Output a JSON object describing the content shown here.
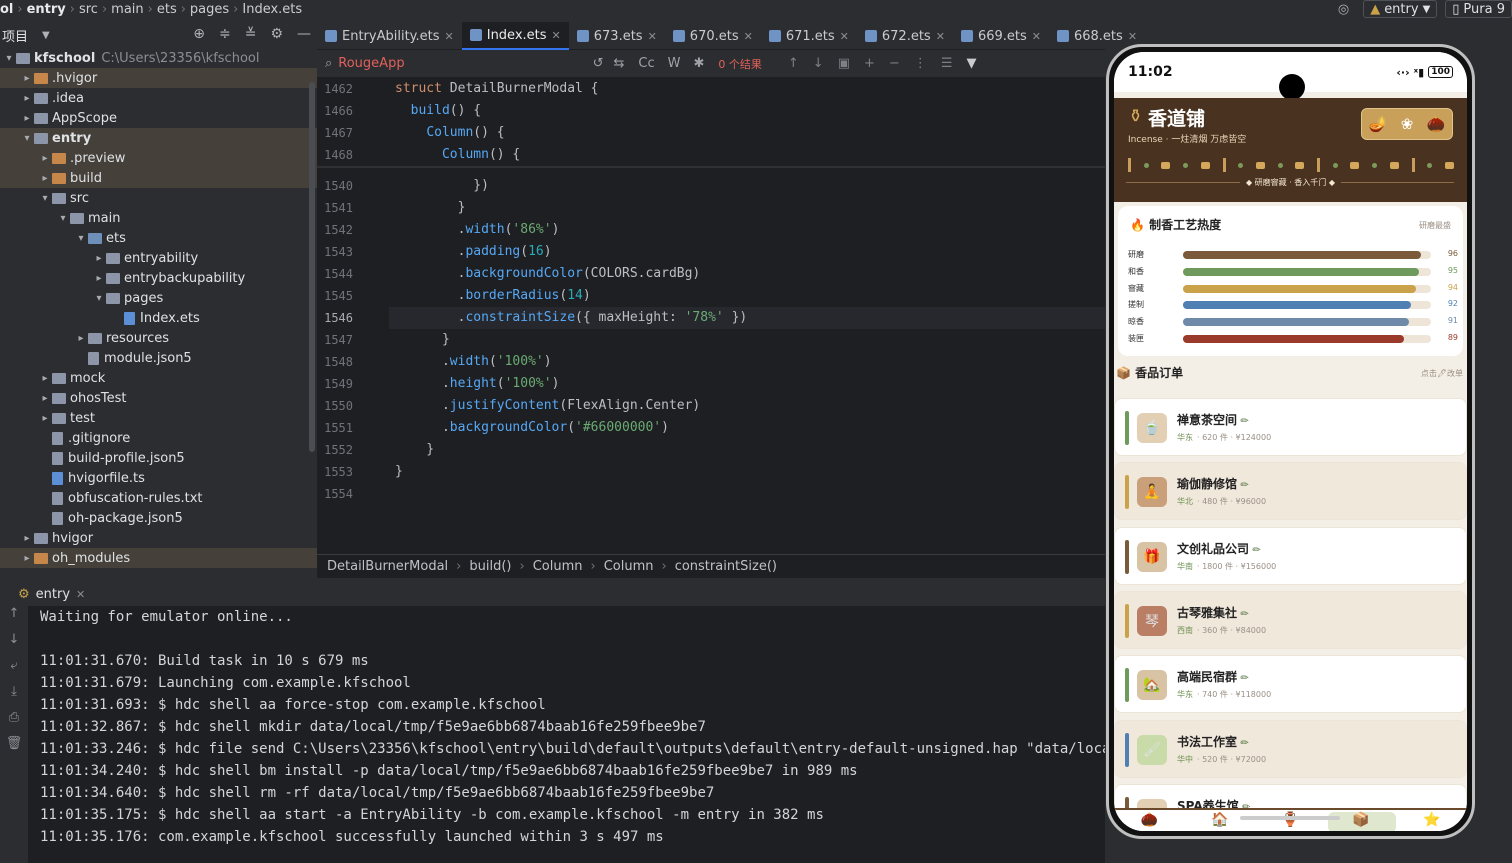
{
  "top_breadcrumb": {
    "items": [
      "ol",
      "entry",
      "src",
      "main",
      "ets",
      "pages",
      "Index.ets"
    ]
  },
  "run_config": {
    "label": "entry",
    "device": "Pura 9"
  },
  "project": {
    "title": "项目",
    "tree": [
      {
        "label": "kfschool",
        "path": "C:\\Users\\23356\\kfschool",
        "indent": 0,
        "bold": true,
        "arrow": "▾",
        "kind": "folder"
      },
      {
        "label": ".hvigor",
        "indent": 1,
        "arrow": "▸",
        "kind": "folder-orange",
        "hl": true
      },
      {
        "label": ".idea",
        "indent": 1,
        "arrow": "▸",
        "kind": "folder"
      },
      {
        "label": "AppScope",
        "indent": 1,
        "arrow": "▸",
        "kind": "folder"
      },
      {
        "label": "entry",
        "indent": 1,
        "arrow": "▾",
        "kind": "folder",
        "bold": true,
        "hl": true
      },
      {
        "label": ".preview",
        "indent": 2,
        "arrow": "▸",
        "kind": "folder-orange",
        "hl": true
      },
      {
        "label": "build",
        "indent": 2,
        "arrow": "▸",
        "kind": "folder-orange",
        "hl": true
      },
      {
        "label": "src",
        "indent": 2,
        "arrow": "▾",
        "kind": "folder"
      },
      {
        "label": "main",
        "indent": 3,
        "arrow": "▾",
        "kind": "folder"
      },
      {
        "label": "ets",
        "indent": 4,
        "arrow": "▾",
        "kind": "folder-blue"
      },
      {
        "label": "entryability",
        "indent": 5,
        "arrow": "▸",
        "kind": "folder"
      },
      {
        "label": "entrybackupability",
        "indent": 5,
        "arrow": "▸",
        "kind": "folder"
      },
      {
        "label": "pages",
        "indent": 5,
        "arrow": "▾",
        "kind": "folder"
      },
      {
        "label": "Index.ets",
        "indent": 6,
        "arrow": "",
        "kind": "file-ts"
      },
      {
        "label": "resources",
        "indent": 4,
        "arrow": "▸",
        "kind": "folder"
      },
      {
        "label": "module.json5",
        "indent": 4,
        "arrow": "",
        "kind": "file"
      },
      {
        "label": "mock",
        "indent": 2,
        "arrow": "▸",
        "kind": "folder"
      },
      {
        "label": "ohosTest",
        "indent": 2,
        "arrow": "▸",
        "kind": "folder"
      },
      {
        "label": "test",
        "indent": 2,
        "arrow": "▸",
        "kind": "folder"
      },
      {
        "label": ".gitignore",
        "indent": 2,
        "arrow": "",
        "kind": "file"
      },
      {
        "label": "build-profile.json5",
        "indent": 2,
        "arrow": "",
        "kind": "file"
      },
      {
        "label": "hvigorfile.ts",
        "indent": 2,
        "arrow": "",
        "kind": "file-ts"
      },
      {
        "label": "obfuscation-rules.txt",
        "indent": 2,
        "arrow": "",
        "kind": "file"
      },
      {
        "label": "oh-package.json5",
        "indent": 2,
        "arrow": "",
        "kind": "file"
      },
      {
        "label": "hvigor",
        "indent": 1,
        "arrow": "▸",
        "kind": "folder"
      },
      {
        "label": "oh_modules",
        "indent": 1,
        "arrow": "▸",
        "kind": "folder-orange",
        "hl": true
      }
    ]
  },
  "tabs": [
    "EntryAbility.ets",
    "Index.ets",
    "673.ets",
    "670.ets",
    "671.ets",
    "672.ets",
    "669.ets",
    "668.ets"
  ],
  "active_tab": "Index.ets",
  "find": {
    "query": "RougeApp",
    "result": "0 个结果",
    "case_label": "Cc",
    "word_label": "W"
  },
  "editor": {
    "sticky": [
      {
        "n": "1462",
        "html": "<span class=\"kw\">struct</span> <span class=\"ty\">DetailBurnerModal</span> {"
      },
      {
        "n": "1466",
        "html": "  <span class=\"fn\">build</span>() {"
      },
      {
        "n": "1467",
        "html": "    <span class=\"fn\">Column</span>() {"
      },
      {
        "n": "1468",
        "html": "      <span class=\"fn\">Column</span>() {"
      }
    ],
    "lines": [
      {
        "n": "1540",
        "html": "          })"
      },
      {
        "n": "1541",
        "html": "        }"
      },
      {
        "n": "1542",
        "html": "        .<span class=\"fn\">width</span>(<span class=\"st\">'86%'</span>)"
      },
      {
        "n": "1543",
        "html": "        .<span class=\"fn\">padding</span>(<span class=\"nm\">16</span>)"
      },
      {
        "n": "1544",
        "html": "        .<span class=\"fn\">backgroundColor</span>(COLORS.cardBg)"
      },
      {
        "n": "1545",
        "html": "        .<span class=\"fn\">borderRadius</span>(<span class=\"nm\">14</span>)"
      },
      {
        "n": "1546",
        "html": "        .<span class=\"fn\">constraintSize</span>({ maxHeight: <span class=\"st\">'78%'</span> })"
      },
      {
        "n": "1547",
        "html": "      }"
      },
      {
        "n": "1548",
        "html": "      .<span class=\"fn\">width</span>(<span class=\"st\">'100%'</span>)"
      },
      {
        "n": "1549",
        "html": "      .<span class=\"fn\">height</span>(<span class=\"st\">'100%'</span>)"
      },
      {
        "n": "1550",
        "html": "      .<span class=\"fn\">justifyContent</span>(FlexAlign.Center)"
      },
      {
        "n": "1551",
        "html": "      .<span class=\"fn\">backgroundColor</span>(<span class=\"st\">'#66000000'</span>)"
      },
      {
        "n": "1552",
        "html": "    }"
      },
      {
        "n": "1553",
        "html": "}"
      },
      {
        "n": "1554",
        "html": ""
      }
    ],
    "current_line": "1546"
  },
  "editor_breadcrumb": [
    "DetailBurnerModal",
    "build()",
    "Column",
    "Column",
    "constraintSize()"
  ],
  "run_tab": "entry",
  "console_lines": [
    "Waiting for emulator online...",
    "",
    "11:01:31.670: Build task in 10 s 679 ms",
    "11:01:31.679: Launching com.example.kfschool",
    "11:01:31.693: $ hdc shell aa force-stop com.example.kfschool",
    "11:01:32.867: $ hdc shell mkdir data/local/tmp/f5e9ae6bb6874baab16fe259fbee9be7",
    "11:01:33.246: $ hdc file send C:\\Users\\23356\\kfschool\\entry\\build\\default\\outputs\\default\\entry-default-unsigned.hap \"data/local/tmp/",
    "11:01:34.240: $ hdc shell bm install -p data/local/tmp/f5e9ae6bb6874baab16fe259fbee9be7 in 989 ms",
    "11:01:34.640: $ hdc shell rm -rf data/local/tmp/f5e9ae6bb6874baab16fe259fbee9be7",
    "11:01:35.175: $ hdc shell aa start -a EntryAbility -b com.example.kfschool -m entry in 382 ms",
    "11:01:35.176: com.example.kfschool successfully launched within 3 s 497 ms"
  ],
  "phone": {
    "time": "11:02",
    "battery": "100",
    "app_name": "香道铺",
    "subtitle": "Incense · 一炷清烟 万虑皆空",
    "header_caption": "◆ 研磨窨藏 · 香入千门 ◆",
    "header_icons": [
      "🪔",
      "❀",
      "🌰"
    ],
    "craft": {
      "title": "🔥 制香工艺热度",
      "note": "研磨最盛",
      "rows": [
        {
          "label": "研磨",
          "value": 96,
          "color": "#7a5a3a"
        },
        {
          "label": "和香",
          "value": 95,
          "color": "#6e9a5e"
        },
        {
          "label": "窨藏",
          "value": 94,
          "color": "#c9a24a"
        },
        {
          "label": "搓制",
          "value": 92,
          "color": "#4f7fb3"
        },
        {
          "label": "晾香",
          "value": 91,
          "color": "#6f8aa8"
        },
        {
          "label": "装匣",
          "value": 89,
          "color": "#9a3a2a"
        }
      ]
    },
    "orders_title": "📦 香品订单",
    "orders_note": "点击🖊改单",
    "orders": [
      {
        "name": "禅意茶空间",
        "region": "华东",
        "meta": "· 620 件 · ¥124000",
        "icon": "🍵",
        "strip": "#6e9a5e",
        "bg": "#ffffff",
        "iconbg": "#e3cfb3"
      },
      {
        "name": "瑜伽静修馆",
        "region": "华北",
        "meta": "· 480 件 · ¥96000",
        "icon": "🧘",
        "strip": "#c9a24a",
        "bg": "#f1e8dc",
        "iconbg": "#c9a07a"
      },
      {
        "name": "文创礼品公司",
        "region": "华南",
        "meta": "· 1800 件 · ¥156000",
        "icon": "🎁",
        "strip": "#7a5a3a",
        "bg": "#ffffff",
        "iconbg": "#d9c3a5"
      },
      {
        "name": "古琴雅集社",
        "region": "西南",
        "meta": "· 360 件 · ¥84000",
        "icon": "琴",
        "strip": "#c9a24a",
        "bg": "#f1e8dc",
        "iconbg": "#b97e64"
      },
      {
        "name": "高端民宿群",
        "region": "华东",
        "meta": "· 740 件 · ¥118000",
        "icon": "🏡",
        "strip": "#6e9a5e",
        "bg": "#ffffff",
        "iconbg": "#d9c3a5"
      },
      {
        "name": "书法工作室",
        "region": "华中",
        "meta": "· 520 件 · ¥72000",
        "icon": "🖌",
        "strip": "#4f7fb3",
        "bg": "#f1e8dc",
        "iconbg": "#c9dba8"
      },
      {
        "name": "SPA养生馆",
        "region": "",
        "meta": "",
        "icon": "",
        "strip": "#7a5a3a",
        "bg": "#ffffff",
        "iconbg": "#e3cfb3"
      }
    ],
    "nav_icons": [
      "🌰",
      "🏠",
      "🏺",
      "📦",
      "⭐"
    ]
  }
}
